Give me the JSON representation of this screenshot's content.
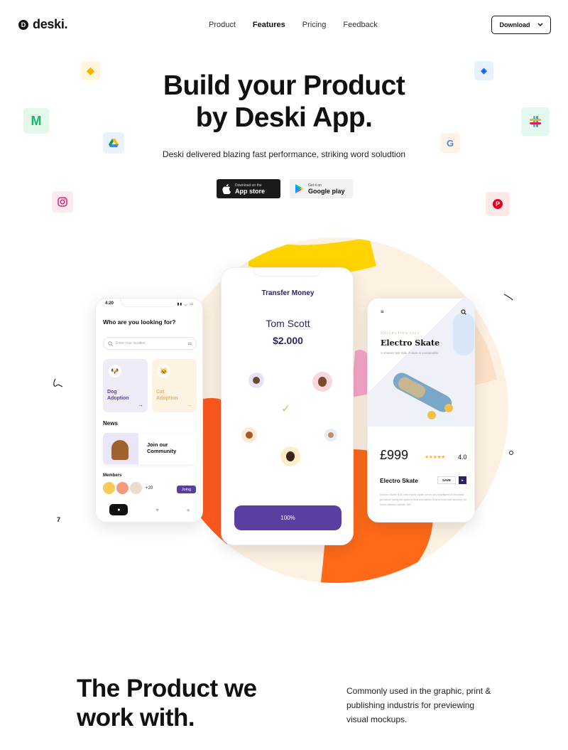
{
  "brand": {
    "name": "deski.",
    "mark": "D"
  },
  "nav": {
    "items": [
      "Product",
      "Features",
      "Pricing",
      "Feedback"
    ],
    "active": "Features",
    "download": "Download"
  },
  "hero": {
    "title_line1": "Build your Product",
    "title_line2": "by Deski App.",
    "subtitle": "Deski delivered blazing fast performance, striking word soludtion"
  },
  "stores": {
    "apple_small": "Download on the",
    "apple_big": "App store",
    "google_small": "Get it on",
    "google_big": "Google play"
  },
  "phone_left": {
    "time": "4:20",
    "heading": "Who are you looking for?",
    "search_placeholder": "Enter your location",
    "card1_line1": "Dog",
    "card1_line2": "Adoption",
    "card2_line1": "Cat",
    "card2_line2": "Adoption",
    "news": "News",
    "join_line1": "Join our",
    "join_line2": "Community",
    "members": "Members",
    "member_count": "+20",
    "join_btn": "Joing"
  },
  "phone_mid": {
    "title": "Transfer Money",
    "name": "Tom Scott",
    "amount": "$2.000",
    "progress": "100%"
  },
  "phone_right": {
    "collection": "COLLECTION 2020",
    "title": "Electro Skate",
    "tagline": "A smarter last mile. Future is sustainable.",
    "price": "£999",
    "stars": "★★★★★",
    "rating": "4.0",
    "product_name": "Electro Skate",
    "save": "SAVE",
    "description": "Electro Skate is a near future skate for an the intelligent AI modular personal transport system that embraces AI and machine learning for more electric vehicle NIC."
  },
  "section2": {
    "title_line1": "The Product we",
    "title_line2": "work with.",
    "text": "Commonly used in the graphic, print & publishing industris for previewing visual mockups."
  },
  "decor": {
    "mark": "7"
  },
  "colors": {
    "accent": "#5b3fa0",
    "orange": "#ff5a1f",
    "yellow": "#ffd400"
  }
}
